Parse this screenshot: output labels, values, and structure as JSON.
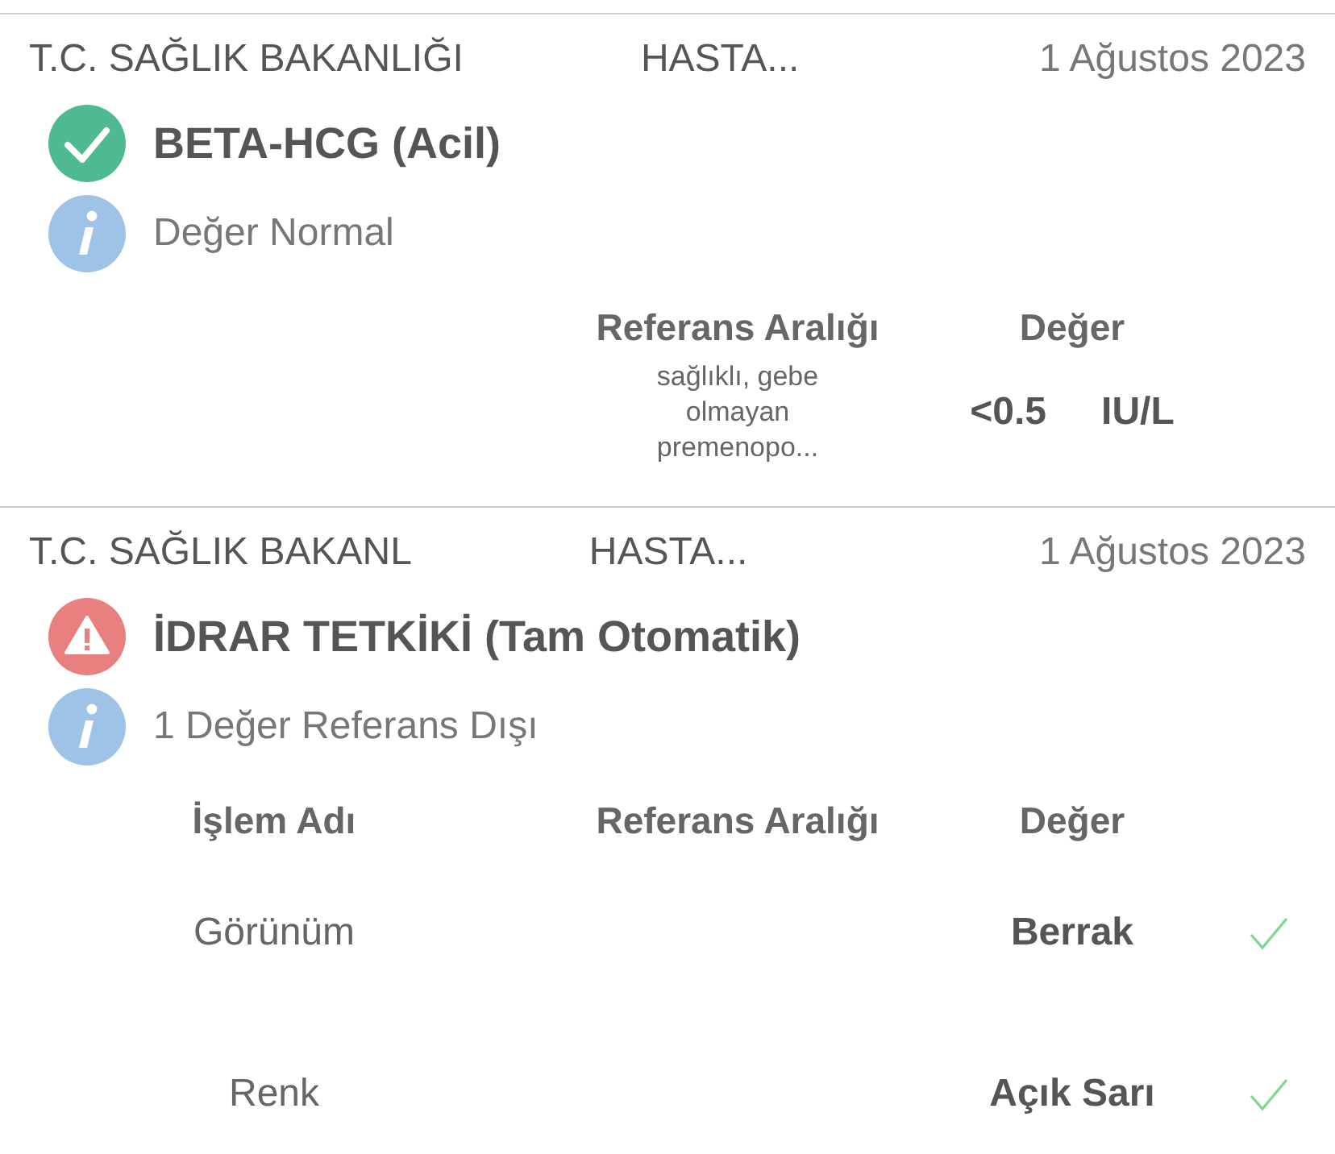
{
  "results": [
    {
      "institution": [
        "T.C. SAĞLIK BAKANLIĞI",
        "HASTA..."
      ],
      "date": "1 Ağustos 2023",
      "kind": "normal",
      "title": "BETA-HCG (Acil)",
      "summary": "Değer Normal",
      "columns": [
        "",
        "Referans Aralığı",
        "Değer"
      ],
      "rows": [
        {
          "reference": "sağlıklı, gebe olmayan premenopo...",
          "value": "<0.5",
          "unit": "IU/L"
        }
      ]
    },
    {
      "institution": [
        "T.C. SAĞLIK BAKANL",
        "HASTA..."
      ],
      "date": "1 Ağustos 2023",
      "kind": "abnormal",
      "title": "İDRAR TETKİKİ (Tam Otomatik)",
      "summary": "1 Değer Referans Dışı",
      "columns": [
        "İşlem Adı",
        "Referans Aralığı",
        "Değer"
      ],
      "rows": [
        {
          "name": "Görünüm",
          "value": "Berrak",
          "normal": true
        },
        {
          "name": "Renk",
          "value": "Açık Sarı",
          "normal": true
        }
      ]
    }
  ]
}
